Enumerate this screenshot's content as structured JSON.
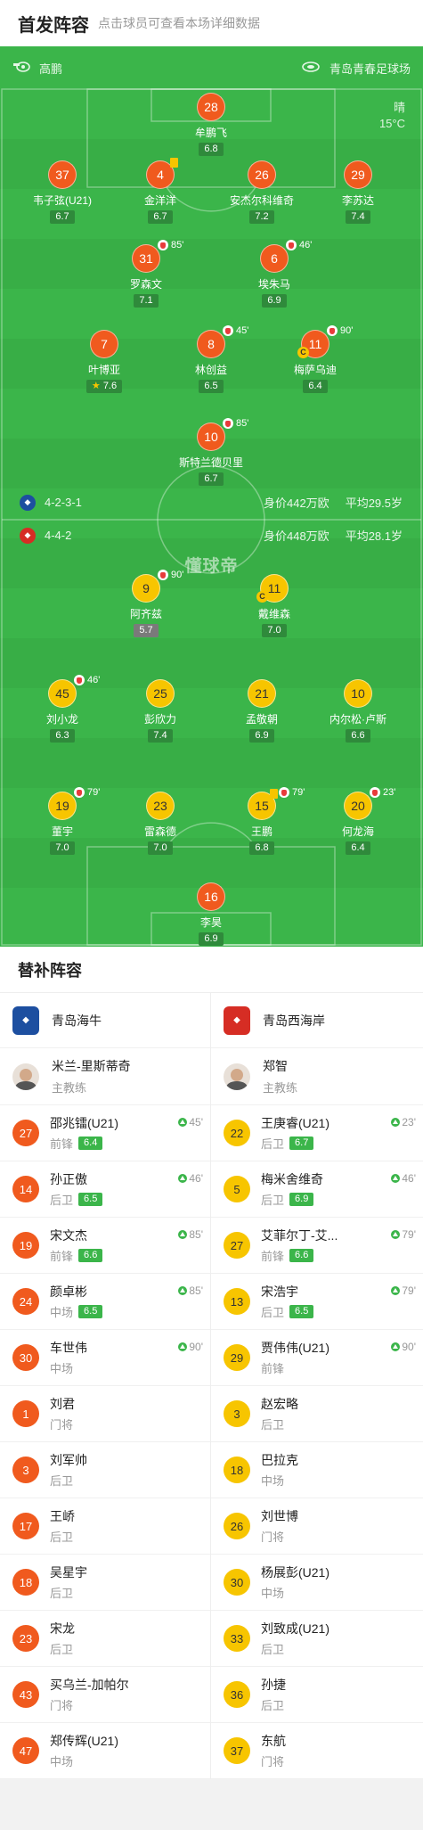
{
  "header": {
    "title": "首发阵容",
    "hint": "点击球员可查看本场详细数据"
  },
  "pitch": {
    "home_coach": "高鹏",
    "venue": "青岛青春足球场",
    "weather": "晴",
    "temperature": "15°C",
    "watermark": "懂球帝",
    "home_formation": "4-2-3-1",
    "home_value": "身价442万欧",
    "home_age": "平均29.5岁",
    "away_formation": "4-4-2",
    "away_value": "身价448万欧",
    "away_age": "平均28.1岁"
  },
  "home_players": [
    {
      "num": "28",
      "name": "牟鹏飞",
      "rating": "6.8"
    },
    {
      "num": "37",
      "name": "韦子弦(U21)",
      "rating": "6.7"
    },
    {
      "num": "4",
      "name": "金洋洋",
      "rating": "6.7",
      "card": "yellow"
    },
    {
      "num": "26",
      "name": "安杰尔科维奇",
      "rating": "7.2"
    },
    {
      "num": "29",
      "name": "李苏达",
      "rating": "7.4"
    },
    {
      "num": "31",
      "name": "罗森文",
      "rating": "7.1",
      "sub": "85'"
    },
    {
      "num": "6",
      "name": "埃朱马",
      "rating": "6.9",
      "sub": "46'"
    },
    {
      "num": "7",
      "name": "叶博亚",
      "rating": "7.6",
      "star": true
    },
    {
      "num": "8",
      "name": "林创益",
      "rating": "6.5",
      "sub": "45'"
    },
    {
      "num": "11",
      "name": "梅萨乌迪",
      "rating": "6.4",
      "sub": "90'",
      "captain": true
    },
    {
      "num": "10",
      "name": "斯特兰德贝里",
      "rating": "6.7",
      "sub": "85'"
    }
  ],
  "away_players": [
    {
      "num": "9",
      "name": "阿齐兹",
      "rating": "5.7",
      "sub": "90'",
      "low": true
    },
    {
      "num": "11",
      "name": "戴维森",
      "rating": "7.0",
      "captain": true
    },
    {
      "num": "45",
      "name": "刘小龙",
      "rating": "6.3",
      "sub": "46'"
    },
    {
      "num": "25",
      "name": "彭欣力",
      "rating": "7.4"
    },
    {
      "num": "21",
      "name": "孟敬朝",
      "rating": "6.9"
    },
    {
      "num": "10",
      "name": "内尔松·卢斯",
      "rating": "6.6"
    },
    {
      "num": "19",
      "name": "董宇",
      "rating": "7.0",
      "sub": "79'"
    },
    {
      "num": "23",
      "name": "雷森德",
      "rating": "7.0"
    },
    {
      "num": "15",
      "name": "王鹏",
      "rating": "6.8",
      "sub": "79'",
      "card": "yellow"
    },
    {
      "num": "20",
      "name": "何龙海",
      "rating": "6.4",
      "sub": "23'"
    },
    {
      "num": "16",
      "name": "李昊",
      "rating": "6.9"
    }
  ],
  "subs": {
    "title": "替补阵容",
    "home": {
      "team": "青岛海牛",
      "coach": "米兰-里斯蒂奇",
      "coach_role": "主教练",
      "players": [
        {
          "num": "27",
          "name": "邵兆镭(U21)",
          "pos": "前锋",
          "rating": "6.4",
          "time": "45'"
        },
        {
          "num": "14",
          "name": "孙正傲",
          "pos": "后卫",
          "rating": "6.5",
          "time": "46'"
        },
        {
          "num": "19",
          "name": "宋文杰",
          "pos": "前锋",
          "rating": "6.6",
          "time": "85'"
        },
        {
          "num": "24",
          "name": "颜卓彬",
          "pos": "中场",
          "rating": "6.5",
          "time": "85'"
        },
        {
          "num": "30",
          "name": "车世伟",
          "pos": "中场",
          "time": "90'"
        },
        {
          "num": "1",
          "name": "刘君",
          "pos": "门将"
        },
        {
          "num": "3",
          "name": "刘军帅",
          "pos": "后卫"
        },
        {
          "num": "17",
          "name": "王峤",
          "pos": "后卫"
        },
        {
          "num": "18",
          "name": "吴星宇",
          "pos": "后卫"
        },
        {
          "num": "23",
          "name": "宋龙",
          "pos": "后卫"
        },
        {
          "num": "43",
          "name": "买乌兰-加帕尔",
          "pos": "门将"
        },
        {
          "num": "47",
          "name": "郑传辉(U21)",
          "pos": "中场"
        }
      ]
    },
    "away": {
      "team": "青岛西海岸",
      "coach": "郑智",
      "coach_role": "主教练",
      "players": [
        {
          "num": "22",
          "name": "王庚睿(U21)",
          "pos": "后卫",
          "rating": "6.7",
          "time": "23'"
        },
        {
          "num": "5",
          "name": "梅米舍维奇",
          "pos": "后卫",
          "rating": "6.9",
          "time": "46'"
        },
        {
          "num": "27",
          "name": "艾菲尔丁-艾...",
          "pos": "前锋",
          "rating": "6.6",
          "time": "79'"
        },
        {
          "num": "13",
          "name": "宋浩宇",
          "pos": "后卫",
          "rating": "6.5",
          "time": "79'"
        },
        {
          "num": "29",
          "name": "贾伟伟(U21)",
          "pos": "前锋",
          "time": "90'"
        },
        {
          "num": "3",
          "name": "赵宏略",
          "pos": "后卫"
        },
        {
          "num": "18",
          "name": "巴拉克",
          "pos": "中场"
        },
        {
          "num": "26",
          "name": "刘世博",
          "pos": "门将"
        },
        {
          "num": "30",
          "name": "杨展彭(U21)",
          "pos": "中场"
        },
        {
          "num": "33",
          "name": "刘致成(U21)",
          "pos": "后卫"
        },
        {
          "num": "36",
          "name": "孙捷",
          "pos": "后卫"
        },
        {
          "num": "37",
          "name": "东航",
          "pos": "门将"
        }
      ]
    }
  },
  "colors": {
    "home": "#f05a1e",
    "away": "#f7c500",
    "pitch": "#3bb54a"
  }
}
